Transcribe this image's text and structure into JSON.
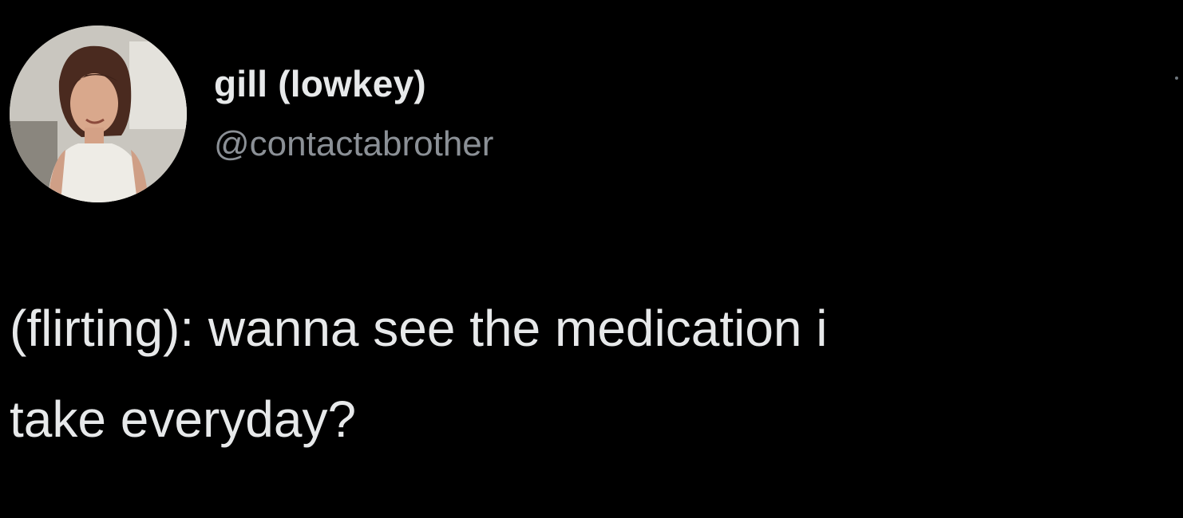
{
  "tweet": {
    "author": {
      "display_name": "gill (lowkey)",
      "handle": "@contactabrother",
      "avatar_icon": "avatar-photo"
    },
    "more_icon": "more-options-icon",
    "text": "(flirting): wanna see the medication i\ntake everyday?"
  },
  "colors": {
    "background": "#000000",
    "primary_text": "#e7e9ea",
    "secondary_text": "#8b9096"
  }
}
